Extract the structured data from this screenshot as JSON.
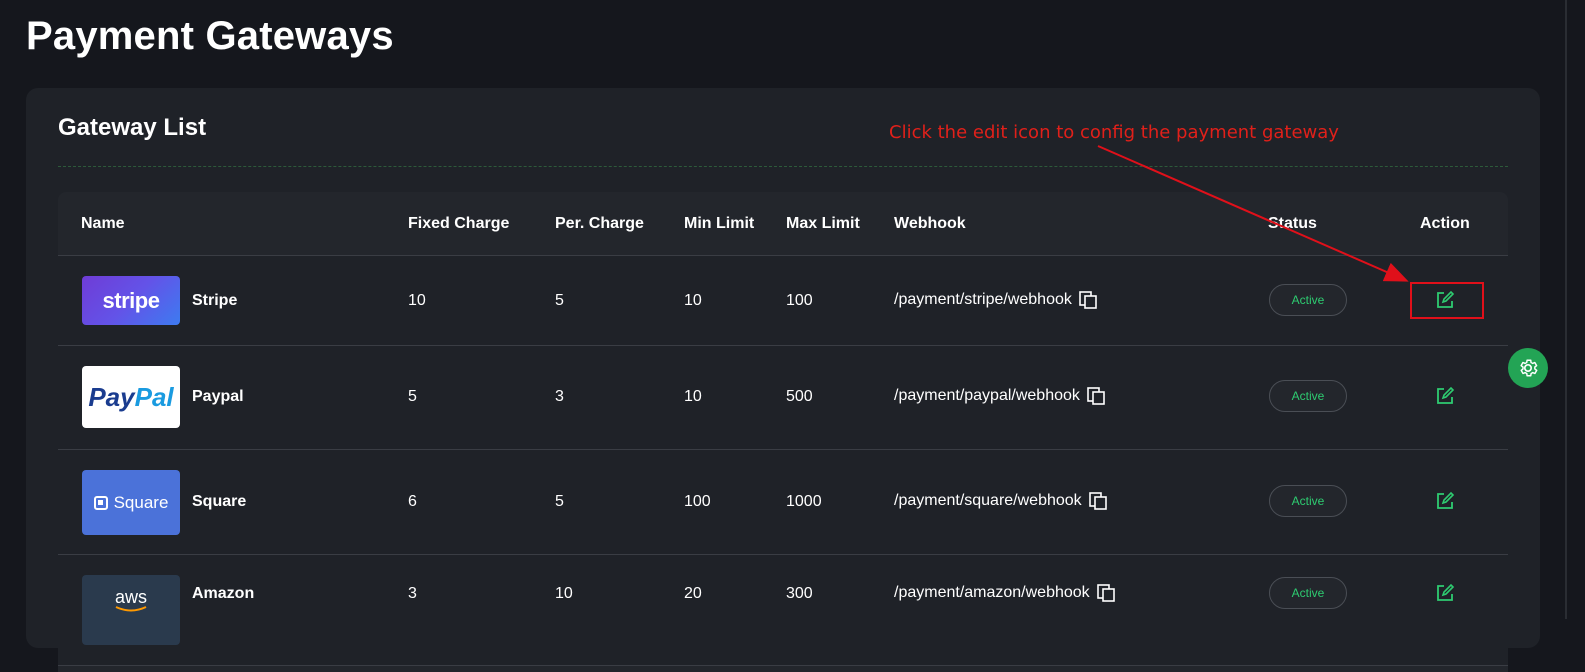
{
  "page": {
    "title": "Payment Gateways"
  },
  "card": {
    "title": "Gateway List"
  },
  "table": {
    "headers": {
      "name": "Name",
      "fixed_charge": "Fixed Charge",
      "per_charge": "Per. Charge",
      "min_limit": "Min Limit",
      "max_limit": "Max Limit",
      "webhook": "Webhook",
      "status": "Status",
      "action": "Action"
    },
    "rows": [
      {
        "logo_text": "stripe",
        "name": "Stripe",
        "fixed_charge": "10",
        "per_charge": "5",
        "min_limit": "10",
        "max_limit": "100",
        "webhook": "/payment/stripe/webhook",
        "status": "Active"
      },
      {
        "logo_text_a": "Pay",
        "logo_text_b": "Pal",
        "name": "Paypal",
        "fixed_charge": "5",
        "per_charge": "3",
        "min_limit": "10",
        "max_limit": "500",
        "webhook": "/payment/paypal/webhook",
        "status": "Active"
      },
      {
        "logo_text": "Square",
        "name": "Square",
        "fixed_charge": "6",
        "per_charge": "5",
        "min_limit": "100",
        "max_limit": "1000",
        "webhook": "/payment/square/webhook",
        "status": "Active"
      },
      {
        "logo_text": "aws",
        "name": "Amazon",
        "fixed_charge": "3",
        "per_charge": "10",
        "min_limit": "20",
        "max_limit": "300",
        "webhook": "/payment/amazon/webhook",
        "status": "Active"
      }
    ]
  },
  "annotation": {
    "text": "Click the edit icon to config the payment gateway",
    "color": "#e0201a"
  },
  "icons": {
    "copy": "copy-icon",
    "edit": "edit-icon",
    "settings": "gear-icon"
  },
  "colors": {
    "background": "#15171d",
    "card": "#1f2228",
    "accent": "#2ecc71",
    "fab": "#23a455",
    "paypal_dark": "#1a3c8f",
    "paypal_light": "#1a9be0"
  }
}
